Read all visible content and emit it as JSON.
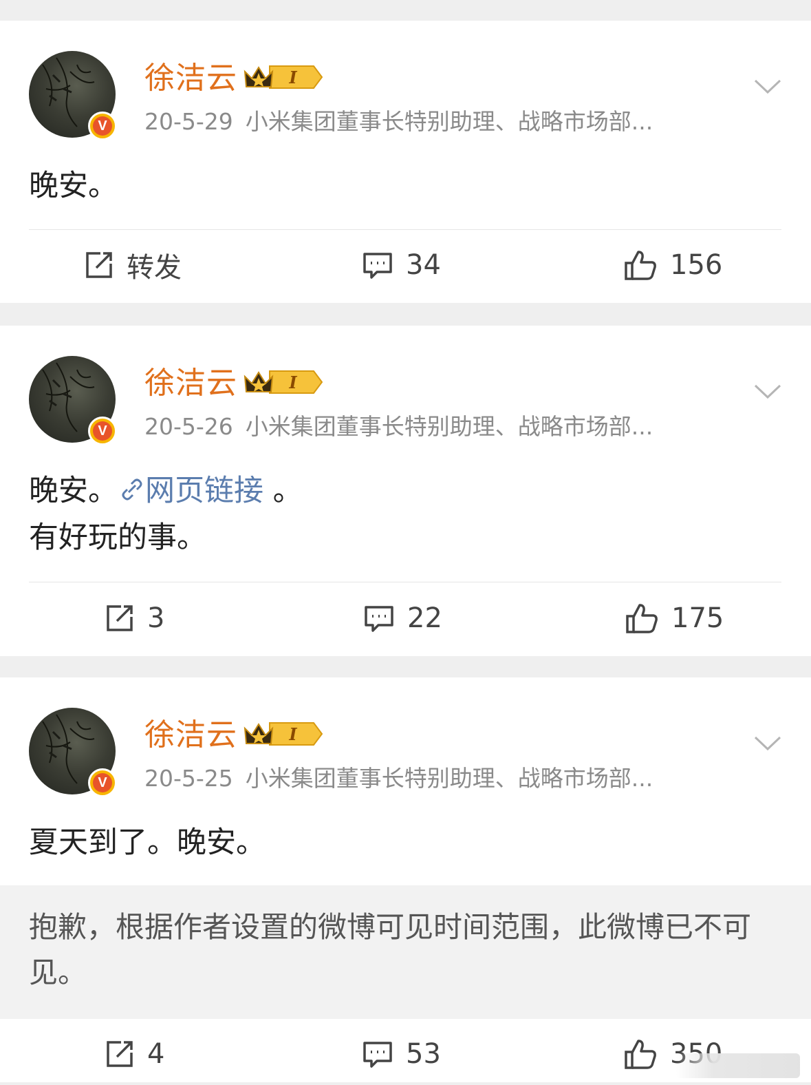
{
  "posts": [
    {
      "author": "徐洁云",
      "level_badge": "I",
      "date": "20-5-29",
      "bio": "小米集团董事长特别助理、战略市场部...",
      "content_line1": "晚安。",
      "repost_label": "转发",
      "comments": "34",
      "likes": "156"
    },
    {
      "author": "徐洁云",
      "level_badge": "I",
      "date": "20-5-26",
      "bio": "小米集团董事长特别助理、战略市场部...",
      "content_line1_pre": "晚安。",
      "content_link": "网页链接",
      "content_line1_post": " 。",
      "content_line2": "有好玩的事。",
      "reposts": "3",
      "comments": "22",
      "likes": "175"
    },
    {
      "author": "徐洁云",
      "level_badge": "I",
      "date": "20-5-25",
      "bio": "小米集团董事长特别助理、战略市场部...",
      "content_line1": "夏天到了。晚安。",
      "notice": "抱歉，根据作者设置的微博可见时间范围，此微博已不可见。",
      "reposts": "4",
      "comments": "53",
      "likes": "350"
    }
  ],
  "icons": {
    "repost": "repost-icon",
    "comment": "comment-icon",
    "like": "thumbs-up-icon",
    "more": "chevron-down-icon",
    "verified": "verified-v-icon",
    "crown": "crown-icon",
    "link": "link-icon"
  },
  "colors": {
    "username": "#e0701c",
    "link": "#5b7dae",
    "meta": "#8a8a8a",
    "verified": "#e8542a"
  }
}
